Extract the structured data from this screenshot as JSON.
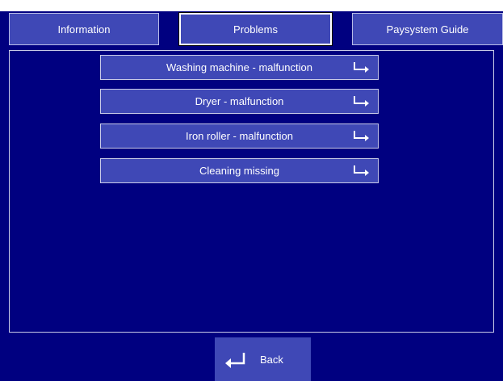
{
  "tabs": [
    {
      "label": "Information",
      "active": false
    },
    {
      "label": "Problems",
      "active": true
    },
    {
      "label": "Paysystem Guide",
      "active": false
    }
  ],
  "problems": [
    {
      "label": "Washing machine - malfunction",
      "icon": "enter-arrow-icon"
    },
    {
      "label": "Dryer - malfunction",
      "icon": "enter-arrow-icon"
    },
    {
      "label": "Iron roller - malfunction",
      "icon": "enter-arrow-icon"
    },
    {
      "label": "Cleaning missing",
      "icon": "enter-arrow-icon"
    }
  ],
  "back": {
    "label": "Back",
    "icon": "return-arrow-icon"
  },
  "colors": {
    "background": "#000080",
    "button": "#3f48b6",
    "border": "#c9cbe8",
    "text": "#ffffff"
  }
}
